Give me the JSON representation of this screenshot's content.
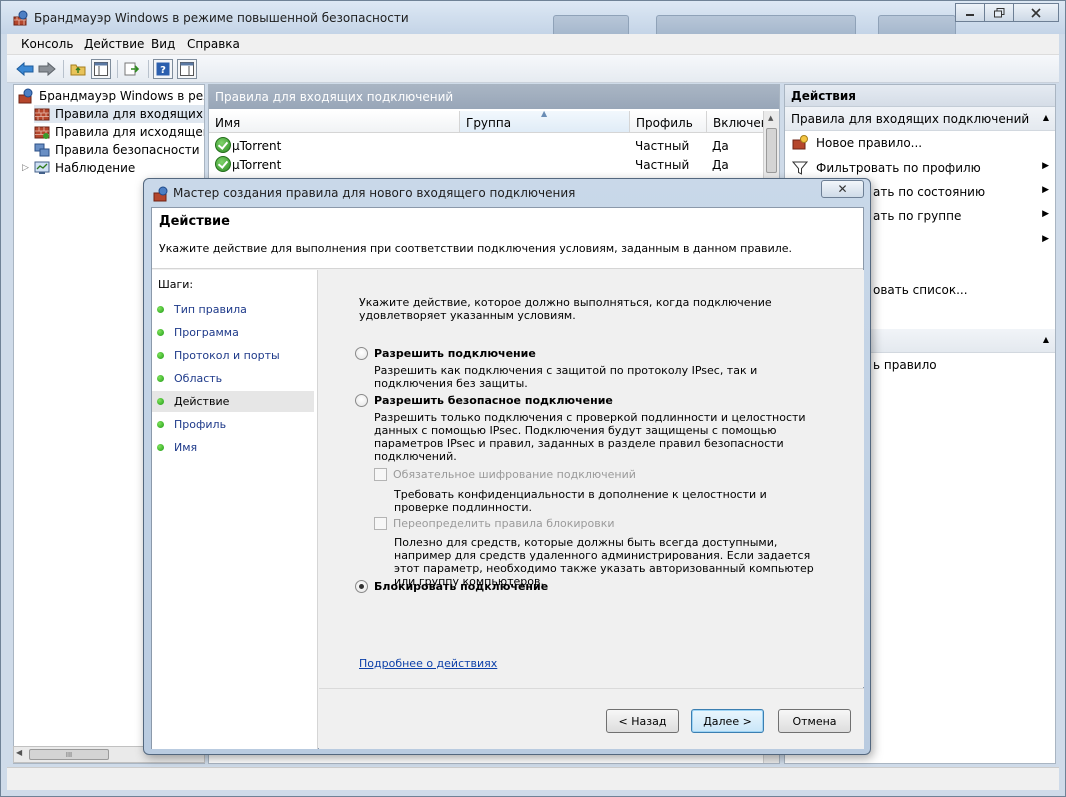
{
  "main_window": {
    "title": "Брандмауэр Windows в режиме повышенной безопасности",
    "menu": [
      "Консоль",
      "Действие",
      "Вид",
      "Справка"
    ]
  },
  "tree": {
    "items": [
      {
        "label": "Брандмауэр Windows в режим"
      },
      {
        "label": "Правила для входящих под"
      },
      {
        "label": "Правила для исходящего п"
      },
      {
        "label": "Правила безопасности по,"
      },
      {
        "label": "Наблюдение",
        "expander": "▷"
      }
    ],
    "hscroll_grip": "III"
  },
  "center": {
    "header": "Правила для входящих подключений",
    "columns": [
      "Имя",
      "Группа",
      "Профиль",
      "Включен"
    ],
    "rows": [
      {
        "name": "µTorrent",
        "group": "",
        "profile": "Частный",
        "enabled": "Да"
      },
      {
        "name": "µTorrent",
        "group": "",
        "profile": "Частный",
        "enabled": "Да"
      }
    ]
  },
  "actions": {
    "header": "Действия",
    "section1": "Правила для входящих подключений",
    "items": [
      {
        "label": "Новое правило..."
      },
      {
        "label": "Фильтровать по профилю"
      },
      {
        "label": "ать по состоянию"
      },
      {
        "label": "ать по группе"
      },
      {
        "label": "овать список..."
      },
      {
        "label": "ь правило"
      }
    ]
  },
  "dialog": {
    "title": "Мастер создания правила для нового входящего подключения",
    "close_label": "✕",
    "header_title": "Действие",
    "header_desc": "Укажите действие для выполнения при соответствии подключения условиям, заданным в данном правиле.",
    "steps_title": "Шаги:",
    "steps": [
      "Тип правила",
      "Программа",
      "Протокол и порты",
      "Область",
      "Действие",
      "Профиль",
      "Имя"
    ],
    "intro": "Укажите действие, которое должно выполняться, когда подключение удовлетворяет указанным условиям.",
    "options": [
      {
        "label": "Разрешить подключение",
        "desc": "Разрешить как подключения с защитой по протоколу IPsec, так и подключения без защиты."
      },
      {
        "label": "Разрешить безопасное подключение",
        "desc": "Разрешить только подключения с проверкой подлинности и целостности данных с помощью IPsec.  Подключения будут защищены с помощью параметров IPsec и правил, заданных в разделе правил безопасности подключений."
      },
      {
        "label": "Блокировать подключение",
        "desc": ""
      }
    ],
    "selected_option": "Блокировать подключение",
    "checkboxes": [
      {
        "label": "Обязательное шифрование подключений",
        "desc": "Требовать конфиденциальности в дополнение к целостности и проверке подлинности."
      },
      {
        "label": "Переопределить правила блокировки",
        "desc": "Полезно для средств, которые должны быть всегда доступными, например для средств удаленного администрирования.  Если задается этот параметр, необходимо также указать авторизованный компьютер или группу компьютеров."
      }
    ],
    "more_link": "Подробнее о действиях",
    "buttons": {
      "back": "< Назад",
      "next": "Далее >",
      "cancel": "Отмена"
    }
  },
  "colors": {
    "link": "#0b3fa8",
    "step_link": "#1e3a8a",
    "panel_header": "#a0aebf",
    "step_dot": "#2fb41f"
  }
}
